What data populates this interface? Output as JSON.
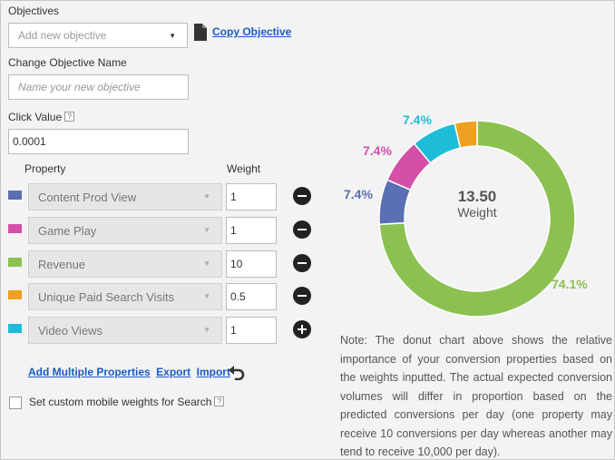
{
  "objectives": {
    "label": "Objectives",
    "dropdown_placeholder": "Add new objective",
    "copy_link": "Copy Objective"
  },
  "change_name": {
    "label": "Change Objective Name",
    "placeholder": "Name your new objective"
  },
  "click_value": {
    "label": "Click Value",
    "help": "?",
    "value": "0.0001"
  },
  "table": {
    "property_header": "Property",
    "weight_header": "Weight",
    "rows": [
      {
        "name": "Content Prod View",
        "weight": "1",
        "color": "#5a6fb4",
        "action": "remove"
      },
      {
        "name": "Game Play",
        "weight": "1",
        "color": "#d44fa8",
        "action": "remove"
      },
      {
        "name": "Revenue",
        "weight": "10",
        "color": "#8cc152",
        "action": "remove"
      },
      {
        "name": "Unique Paid Search Visits",
        "weight": "0.5",
        "color": "#f0a020",
        "action": "remove"
      },
      {
        "name": "Video Views",
        "weight": "1",
        "color": "#1fbcd9",
        "action": "add"
      }
    ]
  },
  "links": {
    "add_multiple": "Add Multiple Properties",
    "export": "Export",
    "import": "Import"
  },
  "mobile": {
    "label": "Set custom mobile weights for Search",
    "help": "?",
    "checked": false
  },
  "chart_data": {
    "type": "pie",
    "variant": "donut",
    "center_value": "13.50",
    "center_label": "Weight",
    "slices": [
      {
        "label": "Revenue",
        "value": 10,
        "pct_label": "74.1%",
        "color": "#8cc152"
      },
      {
        "label": "Content Prod View",
        "value": 1,
        "pct_label": "7.4%",
        "color": "#5a6fb4"
      },
      {
        "label": "Game Play",
        "value": 1,
        "pct_label": "7.4%",
        "color": "#d44fa8"
      },
      {
        "label": "Video Views",
        "value": 1,
        "pct_label": "7.4%",
        "color": "#1fbcd9"
      },
      {
        "label": "Unique Paid Search Visits",
        "value": 0.5,
        "pct_label": "",
        "color": "#f0a020"
      }
    ]
  },
  "note": "Note: The donut chart above shows the relative importance of your conversion properties based on the weights inputted. The actual expected conversion volumes will differ in proportion based on the predicted conversions per day (one property may receive 10 conversions per day whereas another may tend to receive 10,000 per day)."
}
